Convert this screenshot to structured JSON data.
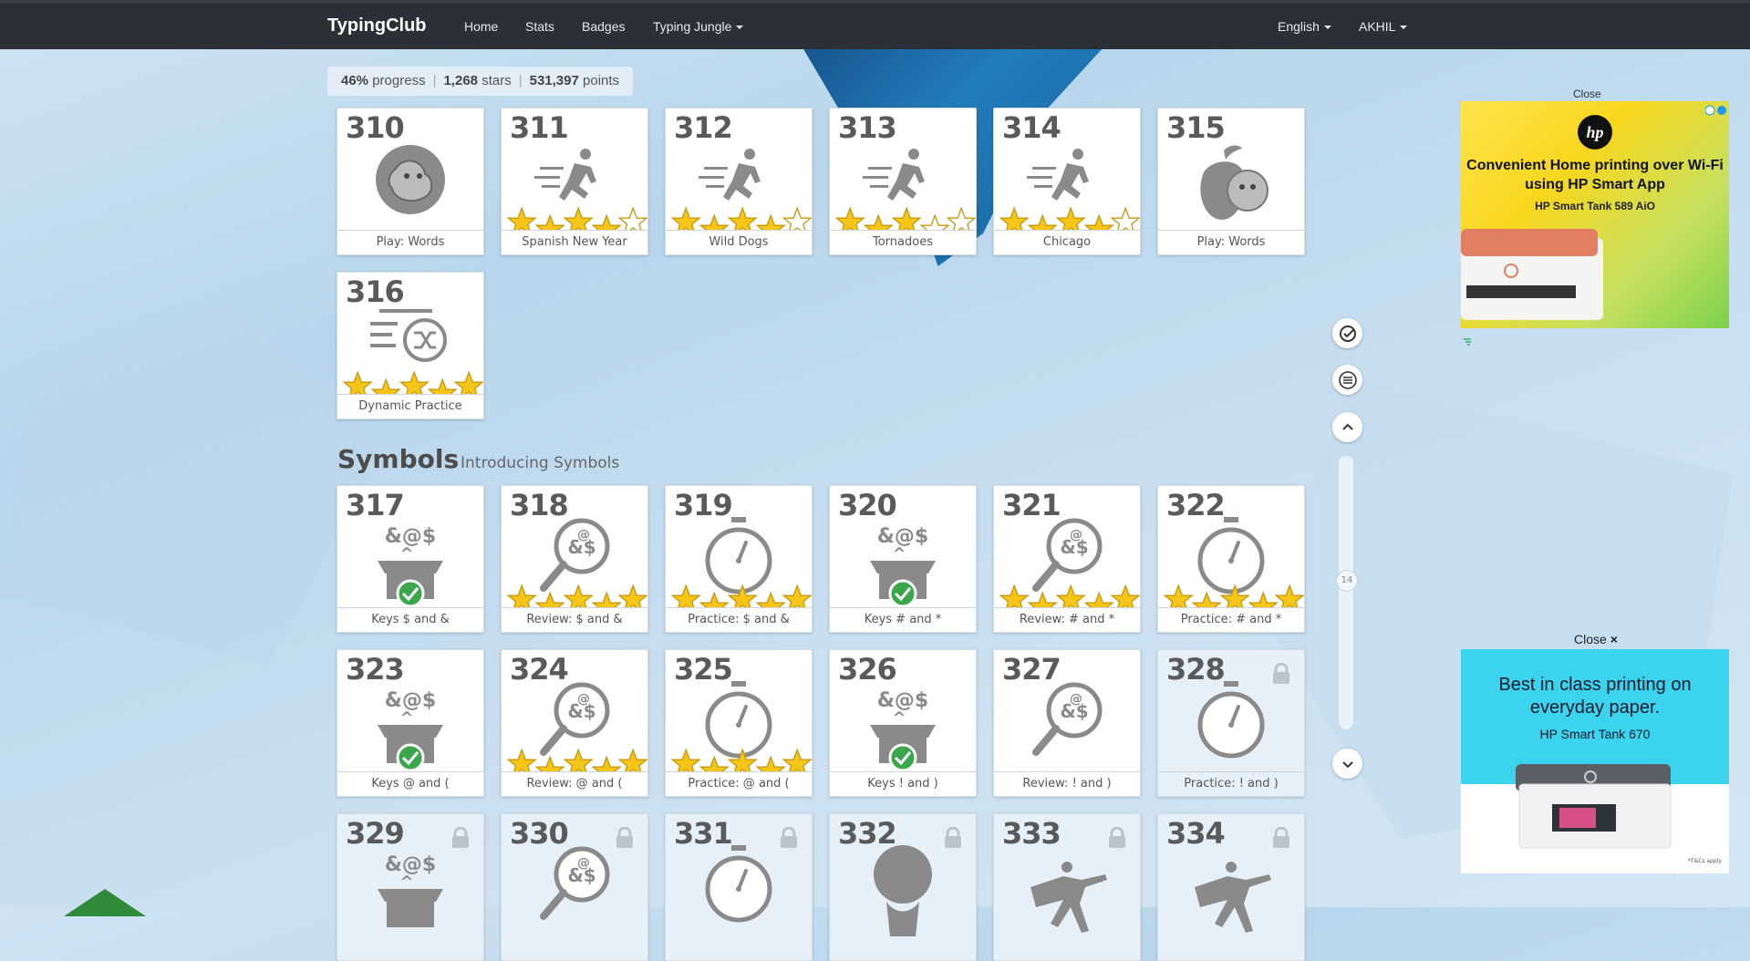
{
  "nav": {
    "brand": "TypingClub",
    "home": "Home",
    "stats": "Stats",
    "badges": "Badges",
    "jungle": "Typing Jungle",
    "language": "English",
    "user": "AKHIL"
  },
  "progress": {
    "percent": "46%",
    "percent_label": "progress",
    "stars": "1,268",
    "stars_label": "stars",
    "points": "531,397",
    "points_label": "points"
  },
  "section": {
    "title": "Symbols",
    "subtitle": "Introducing Symbols"
  },
  "lessons": [
    {
      "num": "310",
      "caption": "Play: Words",
      "icon": "game-face-icon",
      "stars": null,
      "locked": false
    },
    {
      "num": "311",
      "caption": "Spanish New Year",
      "icon": "runner-icon",
      "stars": 4,
      "locked": false
    },
    {
      "num": "312",
      "caption": "Wild Dogs",
      "icon": "runner-icon",
      "stars": 4,
      "locked": false
    },
    {
      "num": "313",
      "caption": "Tornadoes",
      "icon": "runner-icon",
      "stars": 3,
      "locked": false
    },
    {
      "num": "314",
      "caption": "Chicago",
      "icon": "runner-icon",
      "stars": 4,
      "locked": false
    },
    {
      "num": "315",
      "caption": "Play: Words",
      "icon": "apple-game-icon",
      "stars": null,
      "locked": false
    },
    {
      "num": "316",
      "caption": "Dynamic Practice",
      "icon": "shuffle-list-icon",
      "stars": 5,
      "locked": false
    },
    {
      "num": "317",
      "caption": "Keys $ and &",
      "icon": "symbol-box-icon",
      "stars": null,
      "check": true,
      "locked": false
    },
    {
      "num": "318",
      "caption": "Review: $ and &",
      "icon": "magnifier-icon",
      "stars": 5,
      "locked": false
    },
    {
      "num": "319",
      "caption": "Practice: $ and &",
      "icon": "stopwatch-icon",
      "stars": 5,
      "locked": false
    },
    {
      "num": "320",
      "caption": "Keys # and *",
      "icon": "symbol-box-icon",
      "stars": null,
      "check": true,
      "locked": false
    },
    {
      "num": "321",
      "caption": "Review: # and *",
      "icon": "magnifier-icon",
      "stars": 5,
      "locked": false
    },
    {
      "num": "322",
      "caption": "Practice: # and *",
      "icon": "stopwatch-icon",
      "stars": 5,
      "locked": false
    },
    {
      "num": "323",
      "caption": "Keys @ and (",
      "icon": "symbol-box-icon",
      "stars": null,
      "check": true,
      "locked": false
    },
    {
      "num": "324",
      "caption": "Review: @ and (",
      "icon": "magnifier-icon",
      "stars": 5,
      "locked": false
    },
    {
      "num": "325",
      "caption": "Practice: @ and (",
      "icon": "stopwatch-icon",
      "stars": 5,
      "locked": false
    },
    {
      "num": "326",
      "caption": "Keys ! and )",
      "icon": "symbol-box-icon",
      "stars": null,
      "check": true,
      "locked": false
    },
    {
      "num": "327",
      "caption": "Review: ! and )",
      "icon": "magnifier-icon",
      "stars": null,
      "locked": false
    },
    {
      "num": "328",
      "caption": "Practice: ! and )",
      "icon": "stopwatch-icon",
      "stars": null,
      "locked": true
    },
    {
      "num": "329",
      "caption": "",
      "icon": "symbol-box-icon",
      "stars": null,
      "locked": true
    },
    {
      "num": "330",
      "caption": "",
      "icon": "magnifier-icon",
      "stars": null,
      "locked": true
    },
    {
      "num": "331",
      "caption": "",
      "icon": "stopwatch-icon",
      "stars": null,
      "locked": true
    },
    {
      "num": "332",
      "caption": "",
      "icon": "balloon-icon",
      "stars": null,
      "locked": true
    },
    {
      "num": "333",
      "caption": "",
      "icon": "yoga-icon",
      "stars": null,
      "locked": true
    },
    {
      "num": "334",
      "caption": "",
      "icon": "yoga-icon",
      "stars": null,
      "locked": true
    }
  ],
  "scroll": {
    "position": "14"
  },
  "ads": {
    "close_top": "Close",
    "ad1_title": "Convenient Home printing over Wi-Fi using HP Smart App",
    "ad1_sub": "HP Smart Tank 589 AiO",
    "ad1_brand": "hp",
    "close_label": "Close",
    "close_x": "×",
    "ad2_title": "Best in class printing on everyday paper.",
    "ad2_sub": "HP Smart Tank 670",
    "ad2_fine": "*T&Cs apply"
  },
  "colors": {
    "navbar": "#2b3036",
    "star": "#f5c518",
    "check": "#3aa84a",
    "ad1_bg": "#f7d71e",
    "ad2_bg": "#3bd3ee"
  }
}
